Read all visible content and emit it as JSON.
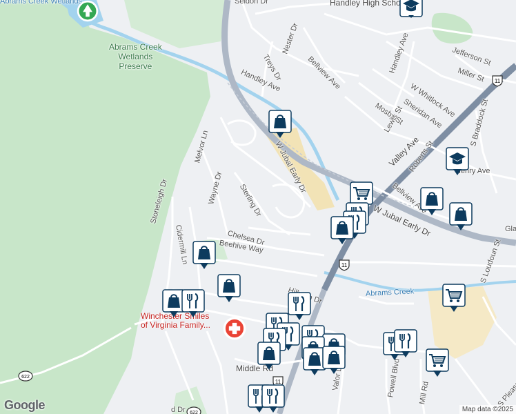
{
  "map": {
    "attribution": "Map data ©2025",
    "logo": "Google",
    "colors": {
      "background": "#eef0f3",
      "park": "#c8e6c9",
      "water": "#a3d3ee",
      "highway": "#aeb8c6",
      "pin_fill": "#0d3b5e",
      "commercial": "#f2e3b6"
    },
    "labels": {
      "abrams_wetlands_top": "Abrams Creek Wetlands",
      "preserve_l1": "Abrams Creek",
      "preserve_l2": "Wetlands",
      "preserve_l3": "Preserve",
      "handley_high": "Handley High School",
      "seldon": "Seldon Dr",
      "jefferson": "Jefferson St",
      "miller": "Miller St",
      "handley_ave_e": "Handley Ave",
      "w_whitlock": "W Whitlock Ave",
      "sheridan": "Sheridan Ave",
      "mosby": "Mosby St",
      "lewis": "Lewis St",
      "treys": "Treys Dr",
      "nester": "Nester Dr",
      "bellview_n": "Bellview Ave",
      "handley_ave_w": "Handley Ave",
      "jubal_n": "W Jubal Early Dr",
      "valley": "Valley Ave",
      "roberts": "Roberts St",
      "s_braddock": "S Braddock St",
      "henry": "Henry Ave",
      "bellview_s": "Bellview Ave",
      "jubal_s": "W Jubal Early Dr",
      "glaize": "Gla",
      "melvor": "Melvor Ln",
      "wayne": "Wayne Dr",
      "sterling": "Sterling Dr",
      "stoneleigh": "Stoneleigh Dr",
      "cidermill": "Cidermill Ln",
      "chelsea": "Chelsea Dr",
      "beehive": "Beehive Way",
      "abrams_creek": "Abrams Creek",
      "s_loudoun": "S Loudoun St",
      "hillman": "Hillman Dr",
      "clinic_l1": "Winchester Smiles",
      "clinic_l2": "of Virginia Family...",
      "middle": "Middle Rd",
      "valor": "Valor Dr",
      "powell": "Powell Blvd",
      "mill": "Mill Rd",
      "s_pleasant": "S Pleasant Valley Rd",
      "fd": "d Dr"
    },
    "shields": {
      "us11_a": "11",
      "us11_b": "11",
      "us11_c": "11",
      "va622": "622",
      "va_bottom": "622"
    }
  }
}
